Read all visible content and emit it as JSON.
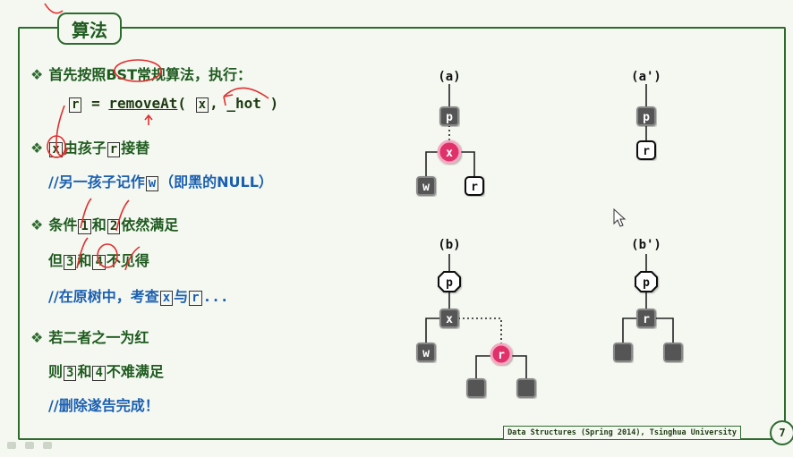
{
  "slide": {
    "title": "算法",
    "footer": "Data Structures (Spring 2014), Tsinghua University",
    "page_number": "7"
  },
  "bullets": {
    "b1": {
      "pre": "首先按照",
      "bst": "BST",
      "post": "常规算法，执行："
    },
    "code": {
      "r": "r",
      "eq": " = ",
      "fn": "removeAt",
      "open": "( ",
      "x": "x",
      "rest": ", _hot )"
    },
    "b2": {
      "x": "x",
      "mid": "由孩子",
      "r": "r",
      "post": "接替"
    },
    "c1": {
      "pre": "//另一孩子记作",
      "w": "w",
      "post": "（即黑的NULL）"
    },
    "b3": {
      "pre": "条件",
      "n1": "1",
      "mid": "和",
      "n2": "2",
      "post": "依然满足"
    },
    "l3": {
      "pre": "但",
      "n3": "3",
      "mid": "和",
      "n4": "4",
      "post": "不见得"
    },
    "c2": {
      "pre": "//在原树中，考查",
      "x": "x",
      "mid": "与",
      "r": "r",
      "post": "..."
    },
    "b4": "若二者之一为红",
    "l4": {
      "pre": "则",
      "n3": "3",
      "mid": "和",
      "n4": "4",
      "post": "不难满足"
    },
    "c3": "//删除遂告完成！"
  },
  "diagrams": {
    "a": {
      "label": "(a)",
      "p": "p",
      "x": "x",
      "w": "w",
      "r": "r"
    },
    "a2": {
      "label": "(a')",
      "p": "p",
      "r": "r"
    },
    "b": {
      "label": "(b)",
      "p": "p",
      "x": "x",
      "w": "w",
      "r": "r"
    },
    "b2": {
      "label": "(b')",
      "p": "p",
      "r": "r"
    }
  },
  "colors": {
    "frame": "#2f6b2f",
    "red_node": "#e0306a",
    "black_node": "#555555",
    "comment": "#1b5fb0"
  }
}
